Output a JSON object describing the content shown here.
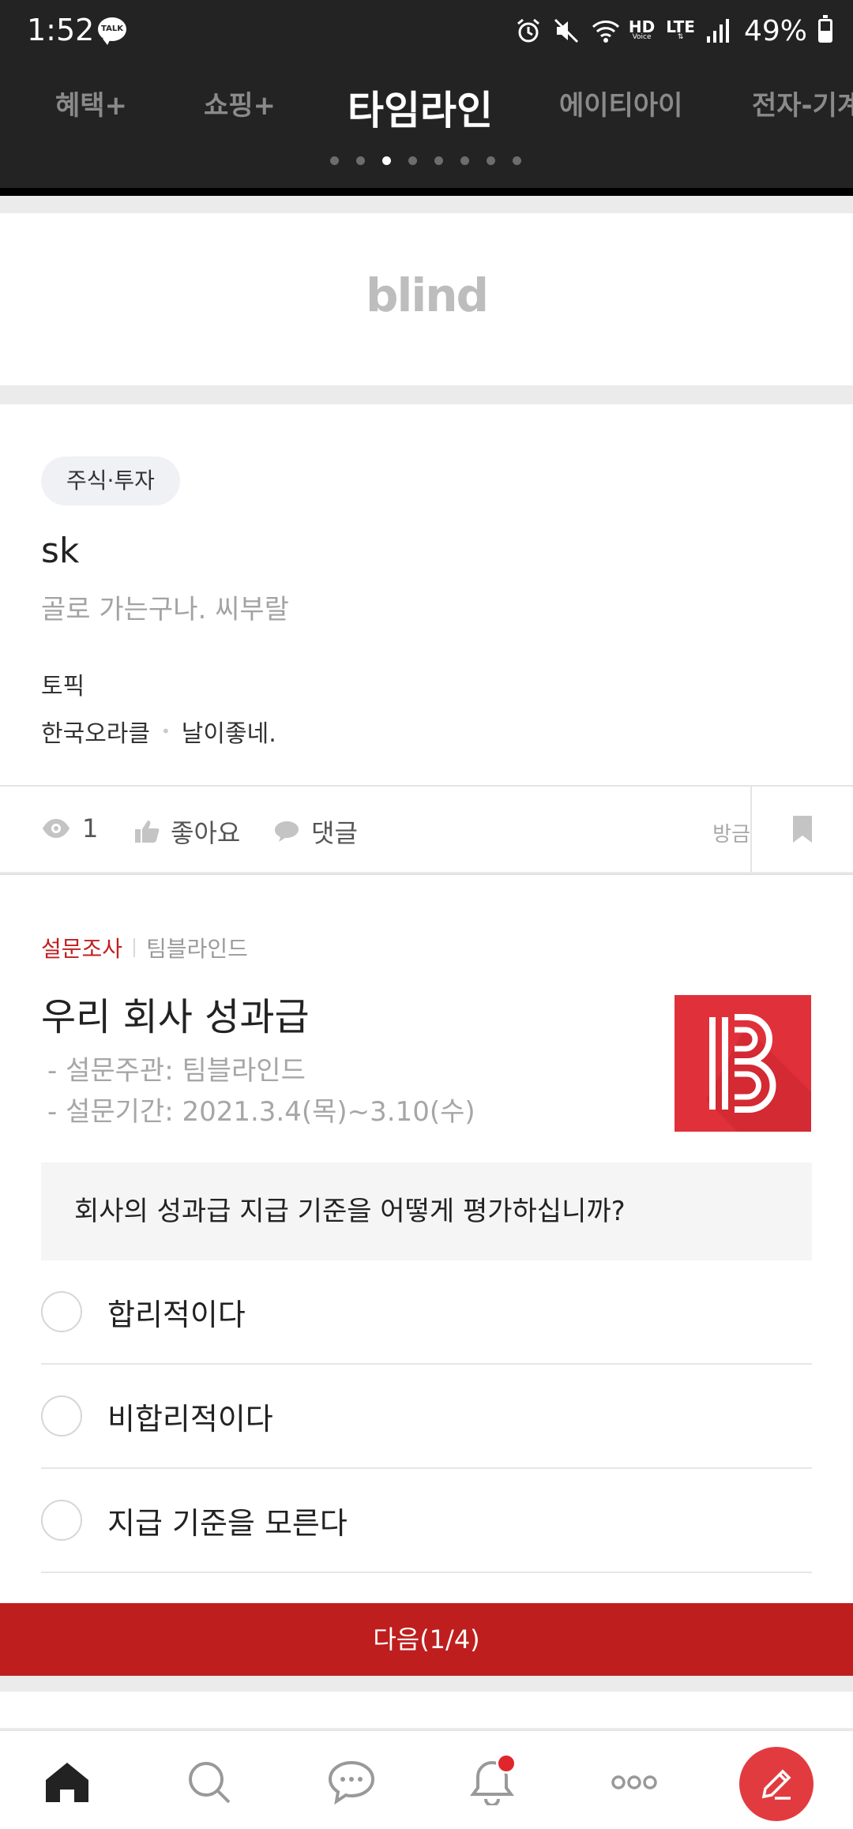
{
  "status_bar": {
    "time": "1:52",
    "talk_badge": "TALK",
    "network_hd": "HD",
    "network_voice": "Voice",
    "network_lte": "LTE",
    "battery": "49%",
    "battery_level": 0.49
  },
  "top_tabs": {
    "items": [
      "혜택+",
      "쇼핑+",
      "타임라인",
      "에이티아이",
      "전자-기계"
    ],
    "active": "타임라인",
    "page_count": 8,
    "page_index": 2
  },
  "banner": {
    "logo_text": "blind"
  },
  "post": {
    "category": "주식·투자",
    "title": "sk",
    "body": "골로 가는구나. 씨부랄",
    "topic_label": "토픽",
    "company": "한국오라클",
    "nickname": "날이좋네.",
    "views": "1",
    "like_label": "좋아요",
    "comment_label": "댓글",
    "time": "방금"
  },
  "survey": {
    "tag": "설문조사",
    "author": "팀블라인드",
    "title": "우리 회사 성과급",
    "organizer": "- 설문주관: 팀블라인드",
    "period": "- 설문기간: 2021.3.4(목)~3.10(수)",
    "question": "회사의 성과급 지급 기준을 어떻게 평가하십니까?",
    "options": [
      "합리적이다",
      "비합리적이다",
      "지급 기준을 모른다"
    ],
    "next_button": "다음(1/4)",
    "brand_color": "#bf1e1e"
  },
  "bottom_nav": {
    "items": [
      "home-icon",
      "search-icon",
      "chat-icon",
      "bell-icon",
      "more-icon",
      "write-icon"
    ],
    "accent": "#e23b3f"
  }
}
